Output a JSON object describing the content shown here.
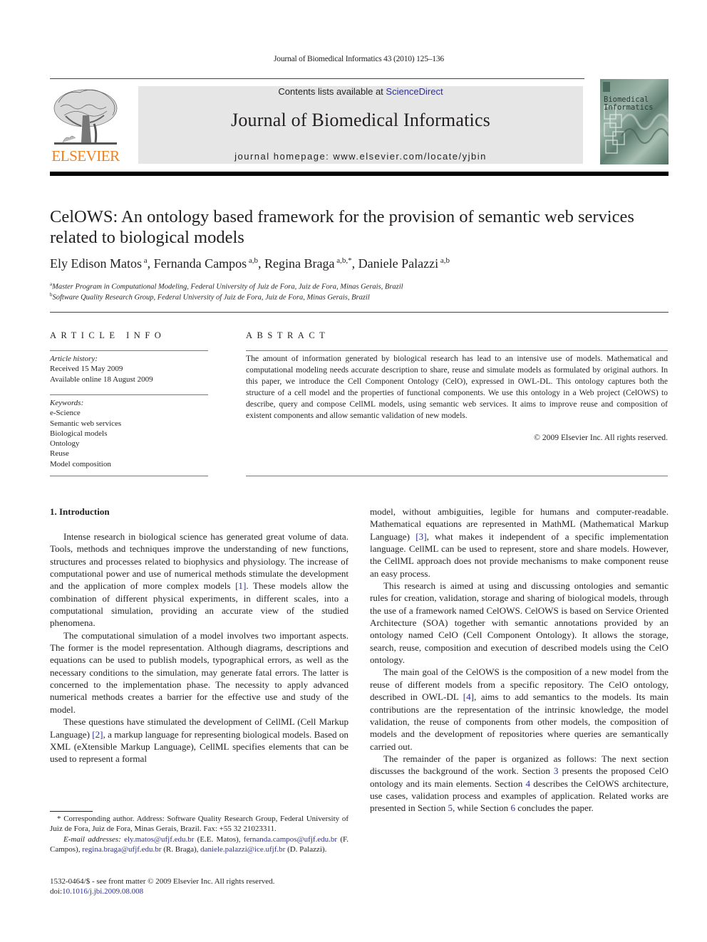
{
  "header": {
    "running_head": "Journal of Biomedical Informatics 43 (2010) 125–136",
    "contents_prefix": "Contents lists available at ",
    "contents_link": "ScienceDirect",
    "journal_title": "Journal of Biomedical Informatics",
    "homepage": "journal homepage: www.elsevier.com/locate/yjbin",
    "publisher_logo_text": "ELSEVIER",
    "cover_title_line1": "Biomedical",
    "cover_title_line2": "Informatics",
    "brand_color": "#f07f1b",
    "link_color": "#2e3192"
  },
  "article": {
    "title": "CelOWS: An ontology based framework for the provision of semantic web services related to biological models",
    "authors": [
      {
        "name": "Ely Edison Matos",
        "sup": "a",
        "sep": ", "
      },
      {
        "name": "Fernanda Campos",
        "sup": "a,b",
        "sep": ", "
      },
      {
        "name": "Regina Braga",
        "sup": "a,b,*",
        "sep": ", "
      },
      {
        "name": "Daniele Palazzi",
        "sup": "a,b",
        "sep": ""
      }
    ],
    "affiliations": [
      {
        "mark": "a",
        "text": "Master Program in Computational Modeling, Federal University of Juiz de Fora, Juiz de Fora, Minas Gerais, Brazil"
      },
      {
        "mark": "b",
        "text": "Software Quality Research Group, Federal University of Juiz de Fora, Juiz de Fora, Minas Gerais, Brazil"
      }
    ]
  },
  "article_info": {
    "heading": "ARTICLE INFO",
    "history_label": "Article history:",
    "received": "Received 15 May 2009",
    "available": "Available online 18 August 2009",
    "keywords_label": "Keywords:",
    "keywords": [
      "e-Science",
      "Semantic web services",
      "Biological models",
      "Ontology",
      "Reuse",
      "Model composition"
    ]
  },
  "abstract": {
    "heading": "ABSTRACT",
    "text": "The amount of information generated by biological research has lead to an intensive use of models. Mathematical and computational modeling needs accurate description to share, reuse and simulate models as formulated by original authors. In this paper, we introduce the Cell Component Ontology (CelO), expressed in OWL-DL. This ontology captures both the structure of a cell model and the properties of functional components. We use this ontology in a Web project (CelOWS) to describe, query and compose CellML models, using semantic web services. It aims to improve reuse and composition of existent components and allow semantic validation of new models.",
    "copyright": "© 2009 Elsevier Inc. All rights reserved."
  },
  "body": {
    "section_title": "1. Introduction",
    "left_paragraphs": [
      {
        "parts": [
          {
            "t": "Intense research in biological science has generated great volume of data. Tools, methods and techniques improve the understanding of new functions, structures and processes related to biophysics and physiology. The increase of computational power and use of numerical methods stimulate the development and the application of more complex models "
          },
          {
            "t": "[1]",
            "link": true
          },
          {
            "t": ". These models allow the combination of different physical experiments, in different scales, into a computational simulation, providing an accurate view of the studied phenomena."
          }
        ]
      },
      {
        "parts": [
          {
            "t": "The computational simulation of a model involves two important aspects. The former is the model representation. Although diagrams, descriptions and equations can be used to publish models, typographical errors, as well as the necessary conditions to the simulation, may generate fatal errors. The latter is concerned to the implementation phase. The necessity to apply advanced numerical methods creates a barrier for the effective use and study of the model."
          }
        ]
      },
      {
        "parts": [
          {
            "t": "These questions have stimulated the development of CellML (Cell Markup Language) "
          },
          {
            "t": "[2]",
            "link": true
          },
          {
            "t": ", a markup language for representing biological models. Based on XML (eXtensible Markup Language), CellML specifies elements that can be used to represent a formal"
          }
        ]
      }
    ],
    "right_paragraphs": [
      {
        "noindent": true,
        "parts": [
          {
            "t": "model, without ambiguities, legible for humans and computer-readable. Mathematical equations are represented in MathML (Mathematical Markup Language) "
          },
          {
            "t": "[3]",
            "link": true
          },
          {
            "t": ", what makes it independent of a specific implementation language. CellML can be used to represent, store and share models. However, the CellML approach does not provide mechanisms to make component reuse an easy process."
          }
        ]
      },
      {
        "parts": [
          {
            "t": "This research is aimed at using and discussing ontologies and semantic rules for creation, validation, storage and sharing of biological models, through the use of a framework named CelOWS. CelOWS is based on Service Oriented Architecture (SOA) together with semantic annotations provided by an ontology named CelO (Cell Component Ontology). It allows the storage, search, reuse, composition and execution of described models using the CelO ontology."
          }
        ]
      },
      {
        "parts": [
          {
            "t": "The main goal of the CelOWS is the composition of a new model from the reuse of different models from a specific repository. The CelO ontology, described in OWL-DL "
          },
          {
            "t": "[4]",
            "link": true
          },
          {
            "t": ", aims to add semantics to the models. Its main contributions are the representation of the intrinsic knowledge, the model validation, the reuse of components from other models, the composition of models and the development of repositories where queries are semantically carried out."
          }
        ]
      },
      {
        "parts": [
          {
            "t": "The remainder of the paper is organized as follows: The next section discusses the background of the work. Section "
          },
          {
            "t": "3",
            "link": true
          },
          {
            "t": " presents the proposed CelO ontology and its main elements. Section "
          },
          {
            "t": "4",
            "link": true
          },
          {
            "t": " describes the CelOWS architecture, use cases, validation process and examples of application. Related works are presented in Section "
          },
          {
            "t": "5",
            "link": true
          },
          {
            "t": ", while Section "
          },
          {
            "t": "6",
            "link": true
          },
          {
            "t": " concludes the paper."
          }
        ]
      }
    ]
  },
  "footnote": {
    "corresponding": "* Corresponding author. Address: Software Quality Research Group, Federal University of Juiz de Fora, Juiz de Fora, Minas Gerais, Brazil. Fax: +55 32 21023311.",
    "email_label": "E-mail addresses:",
    "emails": [
      {
        "addr": "ely.matos@ufjf.edu.br",
        "who": " (E.E. Matos), "
      },
      {
        "addr": "fernanda.campos@ufjf.edu.br",
        "who": " (F. Campos), "
      },
      {
        "addr": "regina.braga@ufjf.edu.br",
        "who": " (R. Braga), "
      },
      {
        "addr": "daniele.palazzi@ice.ufjf.br",
        "who": " (D. Palazzi)."
      }
    ]
  },
  "front_matter": {
    "line1": "1532-0464/$ - see front matter © 2009 Elsevier Inc. All rights reserved.",
    "doi_prefix": "doi:",
    "doi": "10.1016/j.jbi.2009.08.008"
  }
}
